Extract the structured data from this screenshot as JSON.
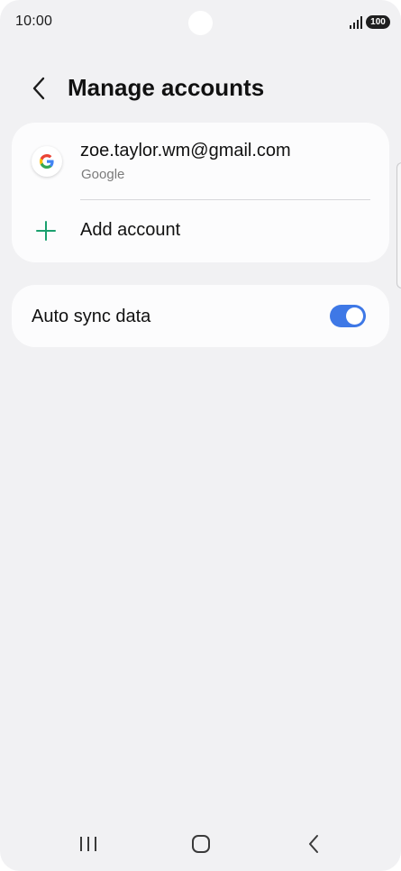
{
  "status_bar": {
    "time": "10:00",
    "battery": "100",
    "signal_icon": "signal-bars-icon"
  },
  "header": {
    "back_icon": "chevron-left-icon",
    "title": "Manage accounts"
  },
  "accounts": {
    "items": [
      {
        "icon": "google-logo-icon",
        "email": "zoe.taylor.wm@gmail.com",
        "provider": "Google"
      }
    ],
    "add_icon": "plus-icon",
    "add_label": "Add account"
  },
  "sync": {
    "label": "Auto sync data",
    "enabled": true
  },
  "nav_bar": {
    "recent_icon": "recent-apps-icon",
    "home_icon": "home-icon",
    "back_icon": "back-icon"
  },
  "colors": {
    "background": "#f1f1f3",
    "card": "#fcfcfd",
    "toggle_on": "#3e78e6",
    "accent_green": "#1a9f6e"
  }
}
